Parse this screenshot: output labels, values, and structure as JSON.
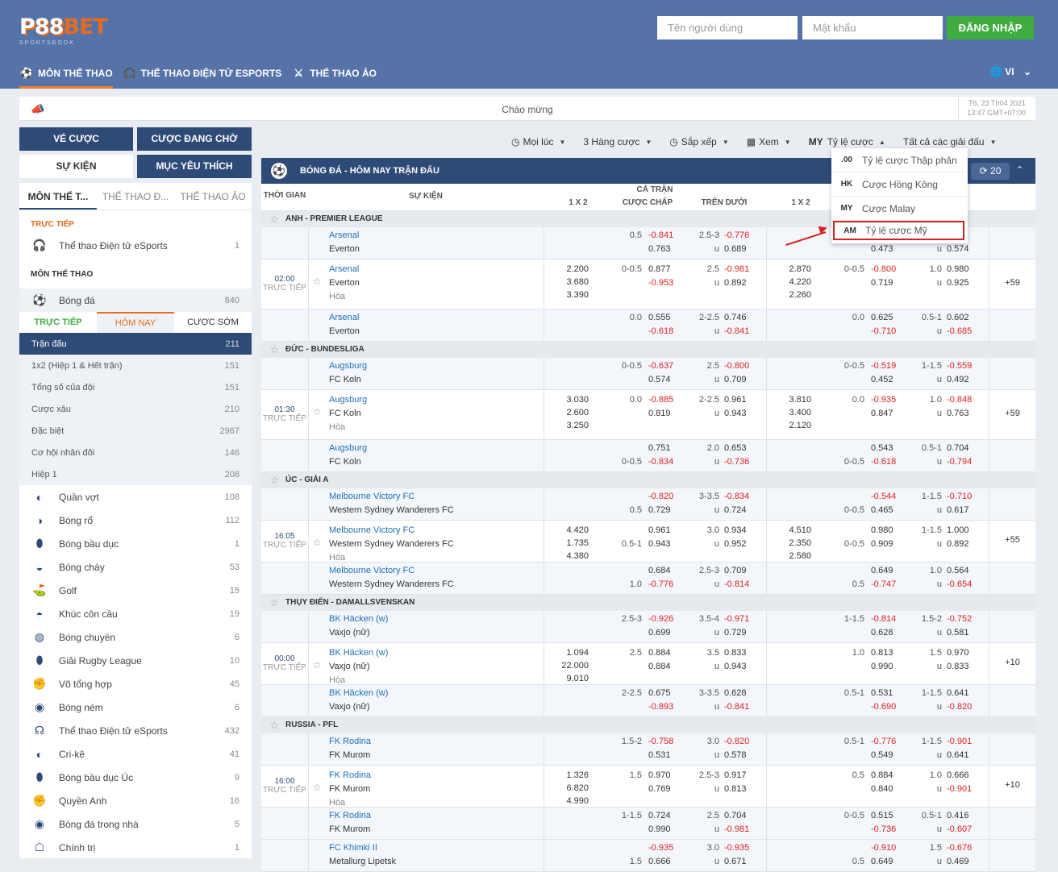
{
  "brand": {
    "logo_main": "P88",
    "logo_accent": "BET",
    "logo_sub": "SPORTSBOOK"
  },
  "login": {
    "user_placeholder": "Tên người dùng",
    "pass_placeholder": "Mật khẩu",
    "button": "ĐĂNG NHẬP"
  },
  "nav": {
    "items": [
      "MÔN THỂ THAO",
      "THỂ THAO ĐIỆN TỬ ESPORTS",
      "THỂ THAO ẢO"
    ],
    "lang": "VI"
  },
  "welcome": {
    "text": "Chào mừng",
    "date": "T6, 23 Th04 2021",
    "time": "13:47 GMT+07:00"
  },
  "side_buttons": {
    "ve_cuoc": "VÉ CƯỢC",
    "cuoc_dang_cho": "CƯỢC ĐANG CHỜ",
    "su_kien": "SỰ KIỆN",
    "muc_yeu_thich": "MỤC YÊU THÍCH"
  },
  "sidebar": {
    "tabs": [
      "MÔN THỂ T...",
      "THỂ THAO Đ...",
      "THỂ THAO ẢO"
    ],
    "live_title": "TRỰC TIẾP",
    "live_items": [
      {
        "label": "Thể thao Điện tử eSports",
        "count": "1"
      }
    ],
    "sports_title": "MÔN THỂ THAO",
    "football": {
      "label": "Bóng đá",
      "count": "840"
    },
    "subtabs": [
      "TRỰC TIẾP",
      "HÔM NAY",
      "CƯỢC SỚM"
    ],
    "markets": [
      {
        "label": "Trận đấu",
        "count": "211"
      },
      {
        "label": "1x2 (Hiệp 1 & Hết trận)",
        "count": "151"
      },
      {
        "label": "Tổng số của đội",
        "count": "151"
      },
      {
        "label": "Cược xâu",
        "count": "210"
      },
      {
        "label": "Đặc biệt",
        "count": "2967"
      },
      {
        "label": "Cơ hội nhân đôi",
        "count": "146"
      },
      {
        "label": "Hiệp 1",
        "count": "208"
      }
    ],
    "sports": [
      {
        "label": "Quần vợt",
        "count": "108",
        "icon": "tennis-icon"
      },
      {
        "label": "Bóng rổ",
        "count": "112",
        "icon": "basketball-icon"
      },
      {
        "label": "Bóng bầu dục",
        "count": "1",
        "icon": "football-icon"
      },
      {
        "label": "Bóng chày",
        "count": "53",
        "icon": "baseball-icon"
      },
      {
        "label": "Golf",
        "count": "15",
        "icon": "golf-icon"
      },
      {
        "label": "Khúc côn cầu",
        "count": "19",
        "icon": "hockey-icon"
      },
      {
        "label": "Bóng chuyền",
        "count": "6",
        "icon": "volleyball-icon"
      },
      {
        "label": "Giải Rugby League",
        "count": "10",
        "icon": "rugby-icon"
      },
      {
        "label": "Võ tổng hợp",
        "count": "45",
        "icon": "mma-icon"
      },
      {
        "label": "Bóng ném",
        "count": "6",
        "icon": "handball-icon"
      },
      {
        "label": "Thể thao Điện tử eSports",
        "count": "432",
        "icon": "headset-icon"
      },
      {
        "label": "Cri-kê",
        "count": "41",
        "icon": "cricket-icon"
      },
      {
        "label": "Bóng bầu dục Úc",
        "count": "9",
        "icon": "aussie-rules-icon"
      },
      {
        "label": "Quyền Anh",
        "count": "16",
        "icon": "boxing-icon"
      },
      {
        "label": "Bóng đá trong nhà",
        "count": "5",
        "icon": "futsal-icon"
      },
      {
        "label": "Chính trị",
        "count": "1",
        "icon": "politics-icon"
      }
    ]
  },
  "toolbar": {
    "time": "Mọi lúc",
    "lines": "3 Hàng cược",
    "sort": "Sắp xếp",
    "view": "Xem",
    "odds_code": "MY",
    "odds": "Tỷ lệ cược",
    "leagues": "Tất cả các giải đấu"
  },
  "odds_menu": [
    {
      "code": ".00",
      "label": "Tỷ lệ cược Thập phân"
    },
    {
      "code": "HK",
      "label": "Cược Hồng Kông"
    },
    {
      "code": "MY",
      "label": "Cược Malay"
    },
    {
      "code": "AM",
      "label": "Tỷ lệ cược Mỹ"
    }
  ],
  "main": {
    "title": "BÓNG ĐÁ - HÔM NAY TRẬN ĐẤU",
    "refresh": "20",
    "cols": {
      "time": "THỜI GIAN",
      "event": "SỰ KIỆN",
      "full": "CẢ TRẬN",
      "x12": "1 X 2",
      "handicap": "CƯỢC CHẤP",
      "ou": "TRÊN DƯỚI",
      "x12b": "1 X 2"
    },
    "leagues": [
      {
        "name": "ANH - PREMIER LEAGUE",
        "time": "02:00",
        "live": "TRỰC TIẾP",
        "more": "+59",
        "rows": [
          {
            "home": "Arsenal",
            "away": "Everton",
            "draw": "",
            "x12": [
              "",
              "",
              ""
            ],
            "hdp_line": [
              "0.5",
              ""
            ],
            "hdp": [
              "-0.841",
              "0.763"
            ],
            "ou_line": [
              "2.5-3",
              "u"
            ],
            "ou": [
              "-0.776",
              "0.689"
            ],
            "x12b": [
              "",
              "",
              ""
            ],
            "hdp2_line": [
              "",
              ""
            ],
            "hdp2": [
              "",
              "0.473"
            ],
            "ou2_line": [
              "",
              "u"
            ],
            "ou2": [
              "0.50",
              "0.574"
            ]
          },
          {
            "home": "Arsenal",
            "away": "Everton",
            "draw": "Hòa",
            "x12": [
              "2.200",
              "3.680",
              "3.390"
            ],
            "hdp_line": [
              "0-0.5",
              ""
            ],
            "hdp": [
              "0.877",
              "-0.953"
            ],
            "ou_line": [
              "2.5",
              "u"
            ],
            "ou": [
              "-0.981",
              "0.892"
            ],
            "x12b": [
              "2.870",
              "4.220",
              "2.260"
            ],
            "hdp2_line": [
              "0-0.5",
              ""
            ],
            "hdp2": [
              "-0.800",
              "0.719"
            ],
            "ou2_line": [
              "1.0",
              "u"
            ],
            "ou2": [
              "0.980",
              "0.925"
            ]
          },
          {
            "home": "Arsenal",
            "away": "Everton",
            "draw": "",
            "x12": [
              "",
              "",
              ""
            ],
            "hdp_line": [
              "0.0",
              ""
            ],
            "hdp": [
              "0.555",
              "-0.618"
            ],
            "ou_line": [
              "2-2.5",
              "u"
            ],
            "ou": [
              "0.746",
              "-0.841"
            ],
            "x12b": [
              "",
              "",
              ""
            ],
            "hdp2_line": [
              "0.0",
              ""
            ],
            "hdp2": [
              "0.625",
              "-0.710"
            ],
            "ou2_line": [
              "0.5-1",
              "u"
            ],
            "ou2": [
              "0.602",
              "-0.685"
            ]
          }
        ]
      },
      {
        "name": "ĐỨC - BUNDESLIGA",
        "time": "01:30",
        "live": "TRỰC TIẾP",
        "more": "+59",
        "rows": [
          {
            "home": "Augsburg",
            "away": "FC Koln",
            "draw": "",
            "x12": [
              "",
              "",
              ""
            ],
            "hdp_line": [
              "0-0.5",
              ""
            ],
            "hdp": [
              "-0.637",
              "0.574"
            ],
            "ou_line": [
              "2.5",
              "u"
            ],
            "ou": [
              "-0.800",
              "0.709"
            ],
            "x12b": [
              "",
              "",
              ""
            ],
            "hdp2_line": [
              "0-0.5",
              ""
            ],
            "hdp2": [
              "-0.519",
              "0.452"
            ],
            "ou2_line": [
              "1-1.5",
              "u"
            ],
            "ou2": [
              "-0.559",
              "0.492"
            ]
          },
          {
            "home": "Augsburg",
            "away": "FC Koln",
            "draw": "Hòa",
            "x12": [
              "3.030",
              "2.600",
              "3.250"
            ],
            "hdp_line": [
              "0.0",
              ""
            ],
            "hdp": [
              "-0.885",
              "0.819"
            ],
            "ou_line": [
              "2-2.5",
              "u"
            ],
            "ou": [
              "0.961",
              "0.943"
            ],
            "x12b": [
              "3.810",
              "3.400",
              "2.120"
            ],
            "hdp2_line": [
              "0.0",
              ""
            ],
            "hdp2": [
              "-0.935",
              "0.847"
            ],
            "ou2_line": [
              "1.0",
              "u"
            ],
            "ou2": [
              "-0.848",
              "0.763"
            ]
          },
          {
            "home": "Augsburg",
            "away": "FC Koln",
            "draw": "",
            "x12": [
              "",
              "",
              ""
            ],
            "hdp_line": [
              "",
              "0-0.5"
            ],
            "hdp": [
              "0.751",
              "-0.834"
            ],
            "ou_line": [
              "2.0",
              "u"
            ],
            "ou": [
              "0.653",
              "-0.736"
            ],
            "x12b": [
              "",
              "",
              ""
            ],
            "hdp2_line": [
              "",
              "0-0.5"
            ],
            "hdp2": [
              "0.543",
              "-0.618"
            ],
            "ou2_line": [
              "0.5-1",
              "u"
            ],
            "ou2": [
              "0.704",
              "-0.794"
            ]
          }
        ]
      },
      {
        "name": "ÚC - GIẢI A",
        "time": "16:05",
        "live": "TRỰC TIẾP",
        "more": "+55",
        "rows": [
          {
            "home": "Melbourne Victory FC",
            "away": "Western Sydney Wanderers FC",
            "draw": "",
            "x12": [
              "",
              "",
              ""
            ],
            "hdp_line": [
              "",
              "0.5"
            ],
            "hdp": [
              "-0.820",
              "0.729"
            ],
            "ou_line": [
              "3-3.5",
              "u"
            ],
            "ou": [
              "-0.834",
              "0.724"
            ],
            "x12b": [
              "",
              "",
              ""
            ],
            "hdp2_line": [
              "",
              "0-0.5"
            ],
            "hdp2": [
              "-0.544",
              "0.465"
            ],
            "ou2_line": [
              "1-1.5",
              "u"
            ],
            "ou2": [
              "-0.710",
              "0.617"
            ]
          },
          {
            "home": "Melbourne Victory FC",
            "away": "Western Sydney Wanderers FC",
            "draw": "Hòa",
            "x12": [
              "4.420",
              "1.735",
              "4.380"
            ],
            "hdp_line": [
              "",
              "0.5-1"
            ],
            "hdp": [
              "0.961",
              "0.943"
            ],
            "ou_line": [
              "3.0",
              "u"
            ],
            "ou": [
              "0.934",
              "0.952"
            ],
            "x12b": [
              "4.510",
              "2.350",
              "2.580"
            ],
            "hdp2_line": [
              "",
              "0-0.5"
            ],
            "hdp2": [
              "0.980",
              "0.909"
            ],
            "ou2_line": [
              "1-1.5",
              "u"
            ],
            "ou2": [
              "1.000",
              "0.892"
            ]
          },
          {
            "home": "Melbourne Victory FC",
            "away": "Western Sydney Wanderers FC",
            "draw": "",
            "x12": [
              "",
              "",
              ""
            ],
            "hdp_line": [
              "",
              "1.0"
            ],
            "hdp": [
              "0.684",
              "-0.776"
            ],
            "ou_line": [
              "2.5-3",
              "u"
            ],
            "ou": [
              "0.709",
              "-0.814"
            ],
            "x12b": [
              "",
              "",
              ""
            ],
            "hdp2_line": [
              "",
              "0.5"
            ],
            "hdp2": [
              "0.649",
              "-0.747"
            ],
            "ou2_line": [
              "1.0",
              "u"
            ],
            "ou2": [
              "0.564",
              "-0.654"
            ]
          }
        ]
      },
      {
        "name": "THỤY ĐIỂN - DAMALLSVENSKAN",
        "time": "00:00",
        "live": "TRỰC TIẾP",
        "more": "+10",
        "rows": [
          {
            "home": "BK Häcken (w)",
            "away": "Vaxjo (nữ)",
            "draw": "",
            "x12": [
              "",
              "",
              ""
            ],
            "hdp_line": [
              "2.5-3",
              ""
            ],
            "hdp": [
              "-0.926",
              "0.699"
            ],
            "ou_line": [
              "3.5-4",
              "u"
            ],
            "ou": [
              "-0.971",
              "0.729"
            ],
            "x12b": [
              "",
              "",
              ""
            ],
            "hdp2_line": [
              "1-1.5",
              ""
            ],
            "hdp2": [
              "-0.814",
              "0.628"
            ],
            "ou2_line": [
              "1.5-2",
              "u"
            ],
            "ou2": [
              "-0.752",
              "0.581"
            ]
          },
          {
            "home": "BK Häcken (w)",
            "away": "Vaxjo (nữ)",
            "draw": "Hòa",
            "x12": [
              "1.094",
              "22.000",
              "9.010"
            ],
            "hdp_line": [
              "2.5",
              ""
            ],
            "hdp": [
              "0.884",
              "0.884"
            ],
            "ou_line": [
              "3.5",
              "u"
            ],
            "ou": [
              "0.833",
              "0.943"
            ],
            "x12b": [
              "",
              "",
              ""
            ],
            "hdp2_line": [
              "1.0",
              ""
            ],
            "hdp2": [
              "0.813",
              "0.990"
            ],
            "ou2_line": [
              "1.5",
              "u"
            ],
            "ou2": [
              "0.970",
              "0.833"
            ]
          },
          {
            "home": "BK Häcken (w)",
            "away": "Vaxjo (nữ)",
            "draw": "",
            "x12": [
              "",
              "",
              ""
            ],
            "hdp_line": [
              "2-2.5",
              ""
            ],
            "hdp": [
              "0.675",
              "-0.893"
            ],
            "ou_line": [
              "3-3.5",
              "u"
            ],
            "ou": [
              "0.628",
              "-0.841"
            ],
            "x12b": [
              "",
              "",
              ""
            ],
            "hdp2_line": [
              "0.5-1",
              ""
            ],
            "hdp2": [
              "0.531",
              "-0.690"
            ],
            "ou2_line": [
              "1-1.5",
              "u"
            ],
            "ou2": [
              "0.641",
              "-0.820"
            ]
          }
        ]
      },
      {
        "name": "RUSSIA - PFL",
        "time": "16:00",
        "live": "TRỰC TIẾP",
        "more": "+10",
        "rows": [
          {
            "home": "FK Rodina",
            "away": "FK Murom",
            "draw": "",
            "x12": [
              "",
              "",
              ""
            ],
            "hdp_line": [
              "1.5-2",
              ""
            ],
            "hdp": [
              "-0.758",
              "0.531"
            ],
            "ou_line": [
              "3.0",
              "u"
            ],
            "ou": [
              "-0.820",
              "0.578"
            ],
            "x12b": [
              "",
              "",
              ""
            ],
            "hdp2_line": [
              "0.5-1",
              ""
            ],
            "hdp2": [
              "-0.776",
              "0.549"
            ],
            "ou2_line": [
              "1-1.5",
              "u"
            ],
            "ou2": [
              "-0.901",
              "0.641"
            ]
          },
          {
            "home": "FK Rodina",
            "away": "FK Murom",
            "draw": "Hòa",
            "x12": [
              "1.326",
              "6.820",
              "4.990"
            ],
            "hdp_line": [
              "1.5",
              ""
            ],
            "hdp": [
              "0.970",
              "0.769"
            ],
            "ou_line": [
              "2.5-3",
              "u"
            ],
            "ou": [
              "0.917",
              "0.813"
            ],
            "x12b": [
              "",
              "",
              ""
            ],
            "hdp2_line": [
              "0.5",
              ""
            ],
            "hdp2": [
              "0.884",
              "0.840"
            ],
            "ou2_line": [
              "1.0",
              "u"
            ],
            "ou2": [
              "0.666",
              "-0.901"
            ]
          },
          {
            "home": "FK Rodina",
            "away": "FK Murom",
            "draw": "",
            "x12": [
              "",
              "",
              ""
            ],
            "hdp_line": [
              "1-1.5",
              ""
            ],
            "hdp": [
              "0.724",
              "0.990"
            ],
            "ou_line": [
              "2.5",
              "u"
            ],
            "ou": [
              "0.704",
              "-0.981"
            ],
            "x12b": [
              "",
              "",
              ""
            ],
            "hdp2_line": [
              "0-0.5",
              ""
            ],
            "hdp2": [
              "0.515",
              "-0.736"
            ],
            "ou2_line": [
              "0.5-1",
              "u"
            ],
            "ou2": [
              "0.416",
              "-0.607"
            ]
          }
        ]
      }
    ],
    "last_row": {
      "home": "FC Khimki II",
      "away": "Metallurg Lipetsk",
      "hdp_line": [
        "",
        "1.5"
      ],
      "hdp": [
        "-0.935",
        "0.666"
      ],
      "ou_line": [
        "3.0",
        "u"
      ],
      "ou": [
        "-0.935",
        "0.671"
      ],
      "hdp2_line": [
        "",
        "0.5"
      ],
      "hdp2": [
        "-0.910",
        "0.649"
      ],
      "ou2_line": [
        "1.5",
        "u"
      ],
      "ou2": [
        "-0.676",
        "0.469"
      ]
    }
  }
}
